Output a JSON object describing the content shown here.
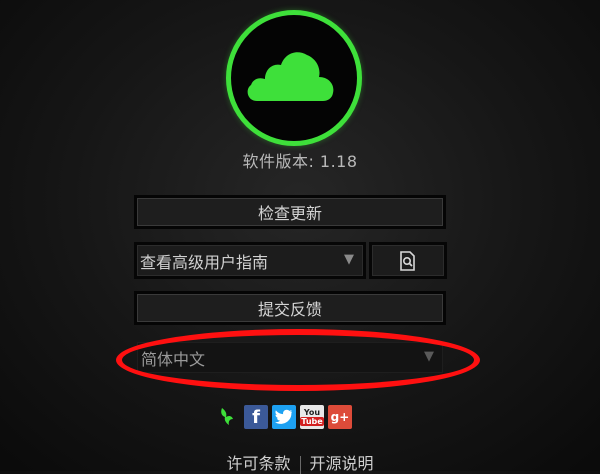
{
  "app": {
    "version_label": "软件版本: 1.18"
  },
  "buttons": {
    "check_update": "检查更新",
    "submit_feedback": "提交反馈"
  },
  "guide_select": {
    "selected": "查看高级用户指南"
  },
  "language_select": {
    "selected": "简体中文"
  },
  "social": {
    "icons": [
      "razer-icon",
      "facebook-icon",
      "twitter-icon",
      "youtube-icon",
      "google-plus-icon"
    ],
    "youtube_top": "You",
    "youtube_bottom": "Tube",
    "gplus_text": "g+"
  },
  "footer": {
    "license": "许可条款",
    "open_source": "开源说明"
  },
  "colors": {
    "accent_green": "#3ee03a",
    "highlight_red": "#ff1010"
  }
}
